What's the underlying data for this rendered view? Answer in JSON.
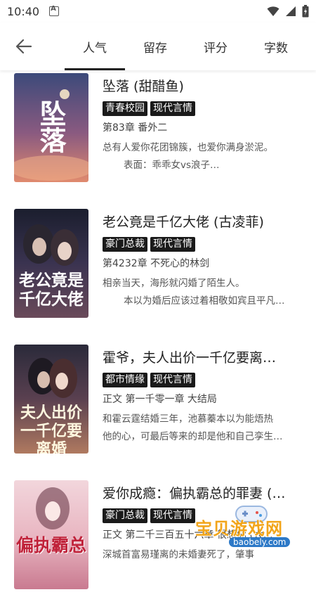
{
  "status": {
    "time": "10:40"
  },
  "tabs": [
    {
      "label": "人气",
      "active": true
    },
    {
      "label": "留存",
      "active": false
    },
    {
      "label": "评分",
      "active": false
    },
    {
      "label": "字数",
      "active": false
    }
  ],
  "books": [
    {
      "title": "坠落 (甜醋鱼)",
      "tags": [
        "青春校园",
        "现代言情"
      ],
      "chapter": "第83章 番外二",
      "desc1": "总有人爱你花团锦簇，也爱你满身淤泥。",
      "desc2": "表面：乖乖女vs浪子…",
      "cover_text": "坠落",
      "cover_colors": [
        "#3c4a7a",
        "#b05a6e",
        "#e08a6e"
      ]
    },
    {
      "title": "老公竟是千亿大佬 (古凌菲)",
      "tags": [
        "豪门总裁",
        "现代言情"
      ],
      "chapter": "第4232章 不死心的林剑",
      "desc1": "相亲当天，海彤就闪婚了陌生人。",
      "desc2": "本以为婚后应该过着相敬如宾且平凡…",
      "cover_text": "老公竟是千亿大佬",
      "cover_colors": [
        "#1b1e2e",
        "#3a3350",
        "#6a4a5a"
      ]
    },
    {
      "title": "霍爷，夫人出价一千亿要离…",
      "tags": [
        "都市情缘",
        "现代言情"
      ],
      "chapter": "正文 第一千零一章 大结局",
      "desc1": "和霍云霆结婚三年，池慕蓁本以为能焐热",
      "desc2": "他的心，可最后等来的却是他和自己孪生…",
      "cover_text": "夫人出价一千亿要离婚",
      "cover_colors": [
        "#2a2a3a",
        "#5a4050",
        "#b07a60"
      ]
    },
    {
      "title": "爱你成瘾：偏执霸总的罪妻 (…",
      "tags": [
        "豪门总裁",
        "现代言情"
      ],
      "chapter": "正文 第二千三百五十六章 很想你 (大…",
      "desc1": "深城首富易瑾离的未婚妻死了，肇事",
      "desc2": "",
      "cover_text": "偏执霸总",
      "cover_colors": [
        "#f2d6dc",
        "#e8b4c0",
        "#c97a90"
      ]
    }
  ],
  "watermark": {
    "text1": "宝贝游戏网",
    "text2": "baobely.com"
  }
}
